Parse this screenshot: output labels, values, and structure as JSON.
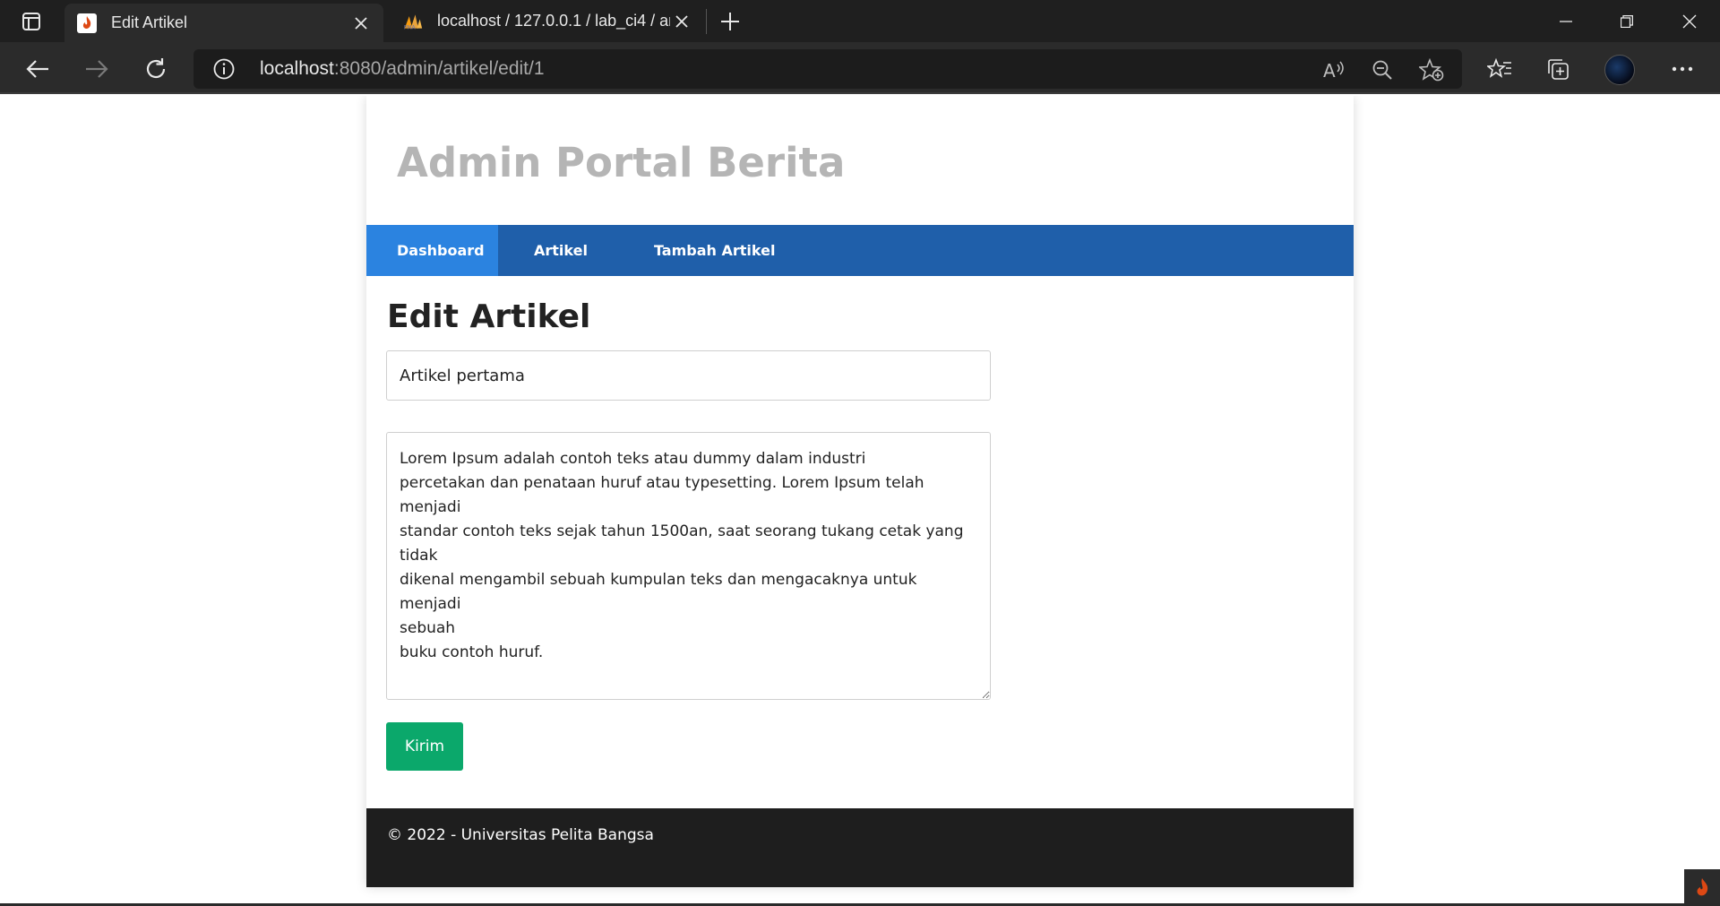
{
  "browser": {
    "tabs": [
      {
        "title": "Edit Artikel",
        "active": true
      },
      {
        "title": "localhost / 127.0.0.1 / lab_ci4 / ar",
        "active": false
      }
    ],
    "url_host": "localhost",
    "url_path": ":8080/admin/artikel/edit/1"
  },
  "site": {
    "title": "Admin Portal Berita",
    "menu": [
      "Dashboard",
      "Artikel",
      "Tambah Artikel"
    ]
  },
  "form": {
    "heading": "Edit Artikel",
    "title_value": "Artikel pertama",
    "body_value": "Lorem Ipsum adalah contoh teks atau dummy dalam industri\npercetakan dan penataan huruf atau typesetting. Lorem Ipsum telah menjadi\nstandar contoh teks sejak tahun 1500an, saat seorang tukang cetak yang tidak\ndikenal mengambil sebuah kumpulan teks dan mengacaknya untuk menjadi\nsebuah\nbuku contoh huruf.",
    "submit_label": "Kirim"
  },
  "footer": {
    "text": "© 2022 - Universitas Pelita Bangsa"
  },
  "colors": {
    "menu_bg": "#1f5faa",
    "menu_active": "#2b83e0",
    "button": "#0ba86b",
    "footer_bg": "#1e1e1e"
  }
}
